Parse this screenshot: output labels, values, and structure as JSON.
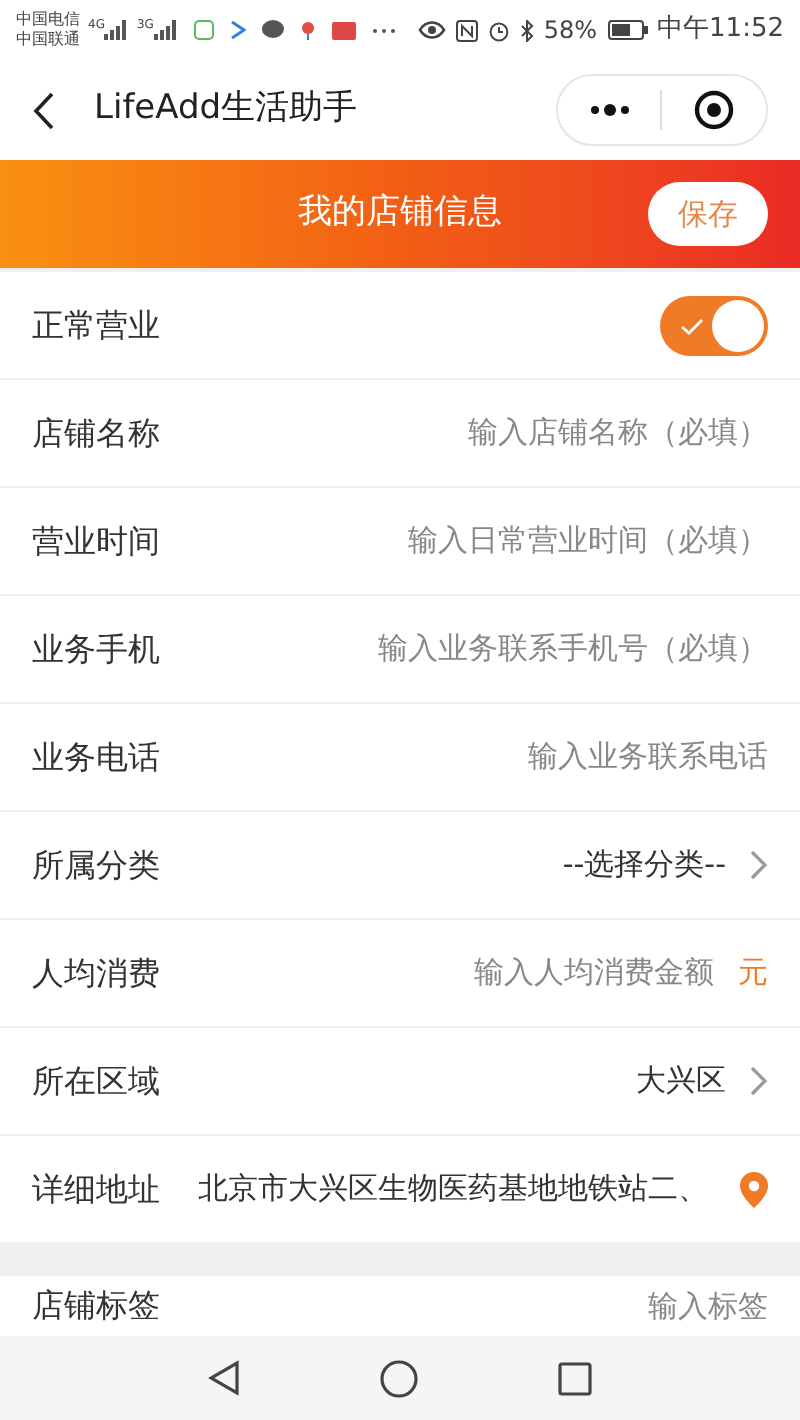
{
  "status_bar": {
    "carrier_1": "中国电信",
    "carrier_2": "中国联通",
    "network_1": "4G",
    "network_2": "3G",
    "battery": "58%",
    "time": "中午11:52"
  },
  "nav": {
    "title": "LifeAdd生活助手"
  },
  "banner": {
    "title": "我的店铺信息",
    "save_button": "保存"
  },
  "fields": [
    {
      "kind": "toggle",
      "label": "正常营业",
      "on": true
    },
    {
      "kind": "input",
      "label": "店铺名称",
      "placeholder": "输入店铺名称（必填）"
    },
    {
      "kind": "input",
      "label": "营业时间",
      "placeholder": "输入日常营业时间（必填）"
    },
    {
      "kind": "input",
      "label": "业务手机",
      "placeholder": "输入业务联系手机号（必填）"
    },
    {
      "kind": "input",
      "label": "业务电话",
      "placeholder": "输入业务联系电话"
    },
    {
      "kind": "select",
      "label": "所属分类",
      "value": "--选择分类--"
    },
    {
      "kind": "unit",
      "label": "人均消费",
      "placeholder": "输入人均消费金额",
      "unit": "元"
    },
    {
      "kind": "select",
      "label": "所在区域",
      "value": "大兴区"
    },
    {
      "kind": "location",
      "label": "详细地址",
      "value": "北京市大兴区生物医药基地地铁站二、"
    }
  ],
  "extra_fields": [
    {
      "kind": "input",
      "label": "店铺标签",
      "placeholder": "输入标签"
    }
  ]
}
